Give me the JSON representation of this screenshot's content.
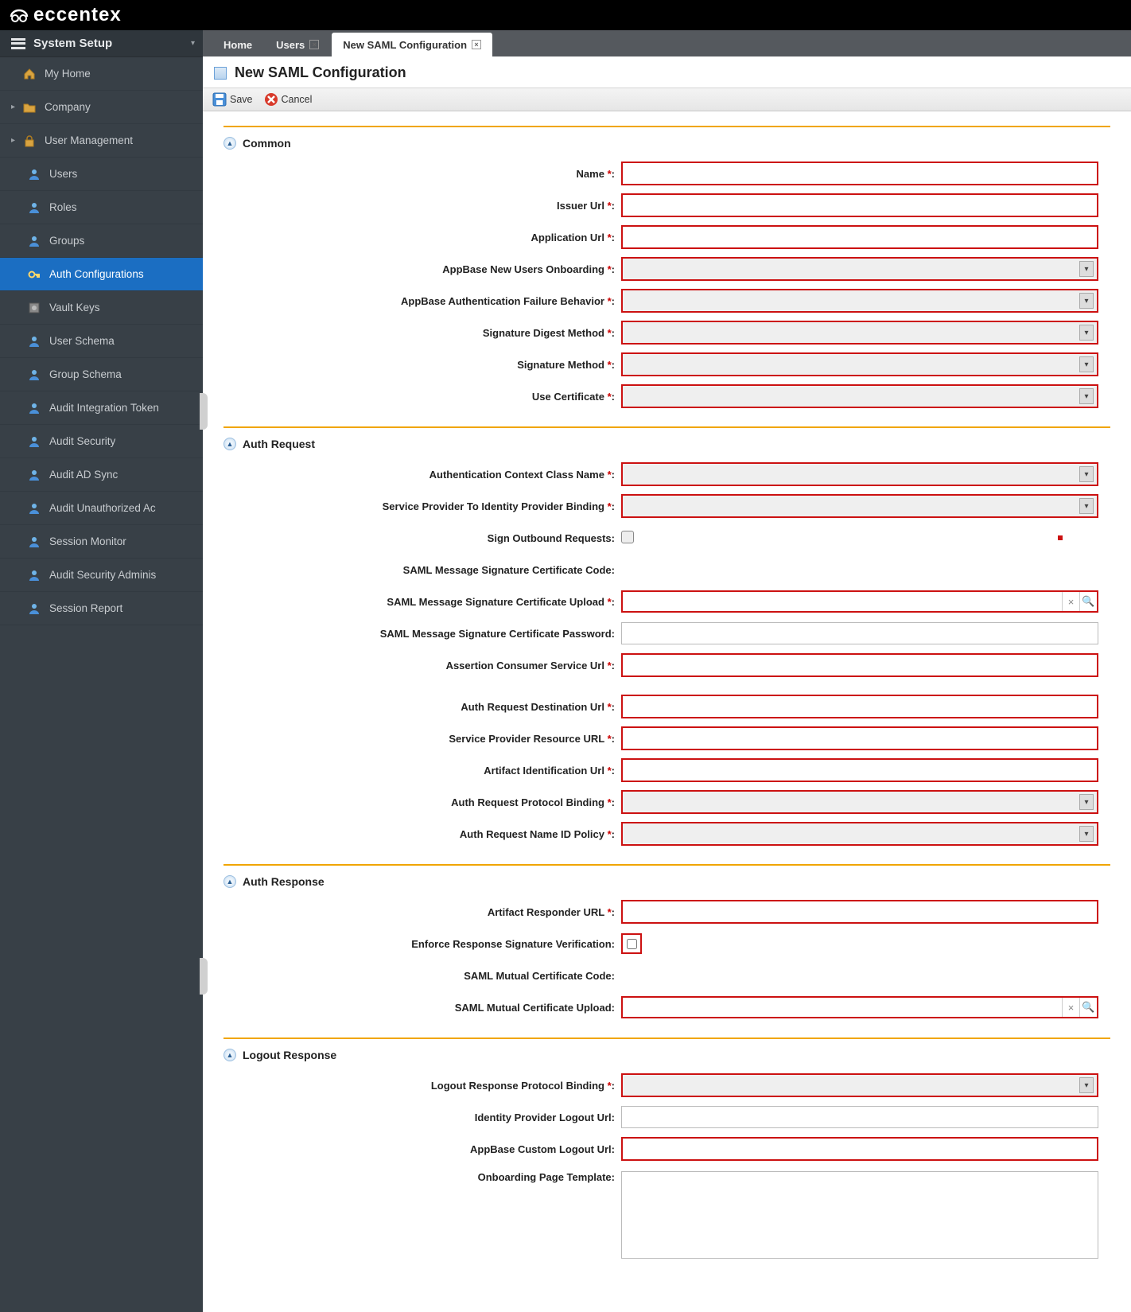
{
  "brand": "eccentex",
  "sidebar": {
    "head": "System Setup",
    "items": [
      {
        "label": "My Home",
        "icon": "home"
      },
      {
        "label": "Company",
        "icon": "folder",
        "caret": true
      },
      {
        "label": "User Management",
        "icon": "lock",
        "caret": true
      },
      {
        "label": "Users",
        "icon": "user",
        "level": 2
      },
      {
        "label": "Roles",
        "icon": "user",
        "level": 2
      },
      {
        "label": "Groups",
        "icon": "user",
        "level": 2
      },
      {
        "label": "Auth Configurations",
        "icon": "key",
        "level": 2,
        "active": true
      },
      {
        "label": "Vault Keys",
        "icon": "vault",
        "level": 2
      },
      {
        "label": "User Schema",
        "icon": "user",
        "level": 2
      },
      {
        "label": "Group Schema",
        "icon": "user",
        "level": 2
      },
      {
        "label": "Audit Integration Token",
        "icon": "user",
        "level": 2
      },
      {
        "label": "Audit Security",
        "icon": "user",
        "level": 2
      },
      {
        "label": "Audit AD Sync",
        "icon": "user",
        "level": 2
      },
      {
        "label": "Audit Unauthorized Ac",
        "icon": "user",
        "level": 2
      },
      {
        "label": "Session Monitor",
        "icon": "user",
        "level": 2
      },
      {
        "label": "Audit Security Adminis",
        "icon": "user",
        "level": 2
      },
      {
        "label": "Session Report",
        "icon": "user",
        "level": 2
      }
    ]
  },
  "tabs": [
    {
      "label": "Home",
      "closable": false
    },
    {
      "label": "Users",
      "closable": true
    },
    {
      "label": "New SAML Configuration",
      "closable": true,
      "active": true
    }
  ],
  "page_title": "New SAML Configuration",
  "toolbar": {
    "save": "Save",
    "cancel": "Cancel"
  },
  "sections": {
    "common": {
      "title": "Common",
      "fields": {
        "name": "Name",
        "issuer_url": "Issuer Url",
        "application_url": "Application Url",
        "onboarding": "AppBase New Users Onboarding",
        "auth_fail": "AppBase Authentication Failure Behavior",
        "sig_digest": "Signature Digest Method",
        "sig_method": "Signature Method",
        "use_cert": "Use Certificate"
      }
    },
    "auth_request": {
      "title": "Auth Request",
      "fields": {
        "ctx_class": "Authentication Context Class Name",
        "sp_to_idp": "Service Provider To Identity Provider Binding",
        "sign_out": "Sign Outbound Requests",
        "sig_cert_code": "SAML Message Signature Certificate Code",
        "sig_cert_upload": "SAML Message Signature Certificate Upload",
        "sig_cert_pass": "SAML Message Signature Certificate Password",
        "acs_url": "Assertion Consumer Service Url",
        "dest_url": "Auth Request Destination Url",
        "sp_res_url": "Service Provider Resource URL",
        "artifact_id_url": "Artifact Identification Url",
        "proto_binding": "Auth Request Protocol Binding",
        "nameid_policy": "Auth Request Name ID Policy"
      }
    },
    "auth_response": {
      "title": "Auth Response",
      "fields": {
        "artifact_resp_url": "Artifact Responder URL",
        "enforce_sig": "Enforce Response Signature Verification",
        "mutual_cert_code": "SAML Mutual Certificate Code",
        "mutual_cert_upload": "SAML Mutual Certificate Upload"
      }
    },
    "logout": {
      "title": "Logout Response",
      "fields": {
        "logout_binding": "Logout Response Protocol Binding",
        "idp_logout": "Identity Provider Logout Url",
        "appbase_logout": "AppBase Custom Logout Url",
        "onboard_tpl": "Onboarding Page Template"
      }
    }
  }
}
